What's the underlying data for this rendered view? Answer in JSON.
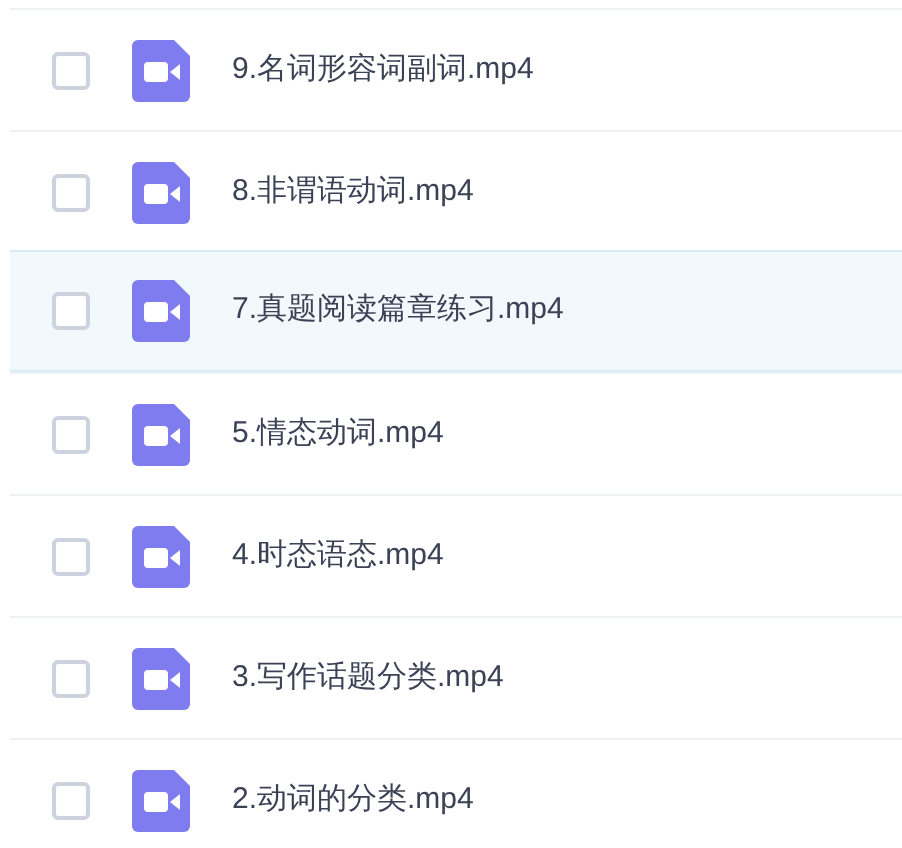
{
  "files": [
    {
      "name": "9.名词形容词副词.mp4",
      "checked": false,
      "highlighted": false
    },
    {
      "name": "8.非谓语动词.mp4",
      "checked": false,
      "highlighted": false
    },
    {
      "name": "7.真题阅读篇章练习.mp4",
      "checked": false,
      "highlighted": true
    },
    {
      "name": "5.情态动词.mp4",
      "checked": false,
      "highlighted": false
    },
    {
      "name": "4.时态语态.mp4",
      "checked": false,
      "highlighted": false
    },
    {
      "name": "3.写作话题分类.mp4",
      "checked": false,
      "highlighted": false
    },
    {
      "name": "2.动词的分类.mp4",
      "checked": false,
      "highlighted": false
    }
  ]
}
